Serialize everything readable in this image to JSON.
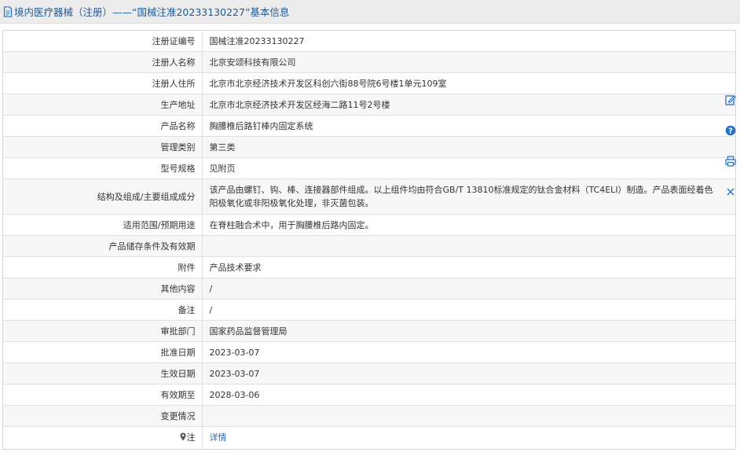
{
  "header": {
    "title": "境内医疗器械（注册）——“国械注准20233130227”基本信息"
  },
  "rows": [
    {
      "label": "注册证编号",
      "value": "国械注准20233130227"
    },
    {
      "label": "注册人名称",
      "value": "北京安颂科技有限公司"
    },
    {
      "label": "注册人住所",
      "value": "北京市北京经济技术开发区科创六街88号院6号楼1单元109室"
    },
    {
      "label": "生产地址",
      "value": "北京市北京经济技术开发区经海二路11号2号楼"
    },
    {
      "label": "产品名称",
      "value": "胸腰椎后路钉棒内固定系统"
    },
    {
      "label": "管理类别",
      "value": "第三类"
    },
    {
      "label": "型号规格",
      "value": "见附页"
    },
    {
      "label": "结构及组成/主要组成成分",
      "value": "该产品由螺钉、钩、棒、连接器部件组成。以上组件均由符合GB/T 13810标准规定的钛合金材料（TC4ELI）制造。产品表面经着色阳极氧化或非阳极氧化处理，非灭菌包装。"
    },
    {
      "label": "适用范围/预期用途",
      "value": "在脊柱融合术中，用于胸腰椎后路内固定。"
    },
    {
      "label": "产品储存条件及有效期",
      "value": ""
    },
    {
      "label": "附件",
      "value": "产品技术要求"
    },
    {
      "label": "其他内容",
      "value": "/"
    },
    {
      "label": "备注",
      "value": "/"
    },
    {
      "label": "审批部门",
      "value": "国家药品监督管理局"
    },
    {
      "label": "批准日期",
      "value": "2023-03-07"
    },
    {
      "label": "生效日期",
      "value": "2023-03-07"
    },
    {
      "label": "有效期至",
      "value": "2028-03-06"
    },
    {
      "label": "变更情况",
      "value": ""
    },
    {
      "label": "注",
      "value": "详情"
    }
  ],
  "colors": {
    "title": "#1e5a96",
    "link": "#1e6cb5",
    "icon": "#2a72c4"
  },
  "side_tools": [
    "edit-icon",
    "help-icon",
    "print-icon",
    "close-icon"
  ]
}
